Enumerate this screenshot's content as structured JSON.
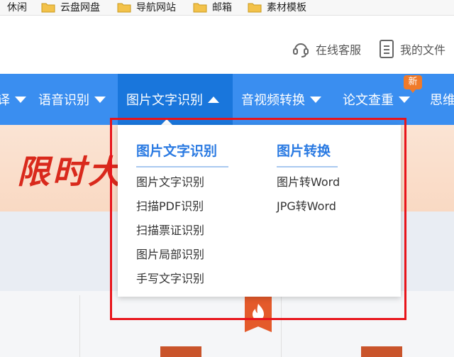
{
  "bookmarks": [
    {
      "label": "休闲"
    },
    {
      "label": "云盘网盘"
    },
    {
      "label": "导航网站"
    },
    {
      "label": "邮箱"
    },
    {
      "label": "素材模板"
    }
  ],
  "header": {
    "customer_service": "在线客服",
    "my_files": "我的文件"
  },
  "nav": {
    "items": [
      {
        "label": "译"
      },
      {
        "label": "语音识别"
      },
      {
        "label": "图片文字识别"
      },
      {
        "label": "音视频转换"
      },
      {
        "label": "论文查重"
      },
      {
        "label": "思维"
      }
    ],
    "new_badge": "新"
  },
  "banner": {
    "text": "限时大"
  },
  "dropdown": {
    "columns": [
      {
        "title": "图片文字识别",
        "items": [
          "图片文字识别",
          "扫描PDF识别",
          "扫描票证识别",
          "图片局部识别",
          "手写文字识别"
        ]
      },
      {
        "title": "图片转换",
        "items": [
          "图片转Word",
          "JPG转Word"
        ]
      }
    ]
  },
  "colors": {
    "nav_bg": "#3a8ef0",
    "nav_active": "#1976dc",
    "accent_blue": "#2a7ae2",
    "highlight_box": "#e8141b",
    "badge_orange": "#f07a2a"
  },
  "icons": [
    "folder-icon",
    "headset-icon",
    "document-icon",
    "fire-icon"
  ]
}
